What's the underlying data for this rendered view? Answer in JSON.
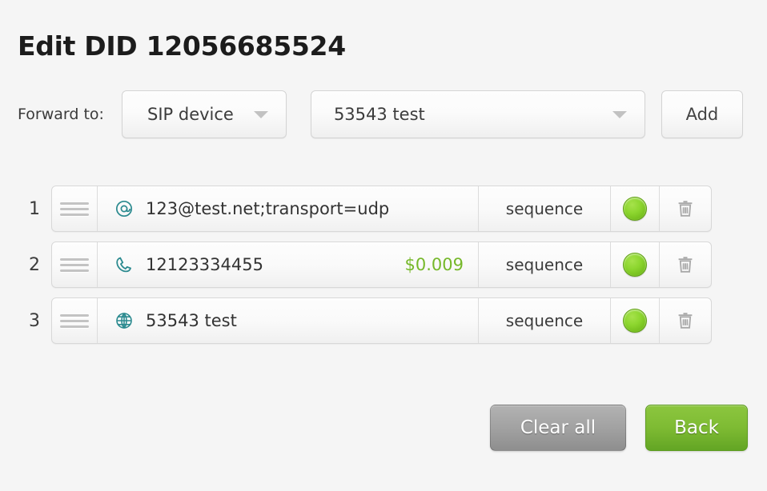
{
  "page": {
    "title": "Edit DID 12056685524",
    "background_color": "#f5f5f5",
    "accent_teal": "#2b8a8f",
    "accent_green": "#76b82a"
  },
  "forward": {
    "label": "Forward to:",
    "type_select": {
      "value": "SIP device",
      "caret_icon": "chevron-down-icon"
    },
    "destination_select": {
      "value": "53543 test",
      "caret_icon": "chevron-down-icon"
    },
    "add_button": "Add"
  },
  "rows": [
    {
      "index": "1",
      "handle_icon": "drag-handle-icon",
      "type_icon": "at-sign-icon",
      "text": "123@test.net;transport=udp",
      "price": "",
      "mode": "sequence",
      "status_icon": "green-led-icon",
      "delete_icon": "trash-icon"
    },
    {
      "index": "2",
      "handle_icon": "drag-handle-icon",
      "type_icon": "phone-icon",
      "text": "12123334455",
      "price": "$0.009",
      "mode": "sequence",
      "status_icon": "green-led-icon",
      "delete_icon": "trash-icon"
    },
    {
      "index": "3",
      "handle_icon": "drag-handle-icon",
      "type_icon": "globe-icon",
      "text": "53543 test",
      "price": "",
      "mode": "sequence",
      "status_icon": "green-led-icon",
      "delete_icon": "trash-icon"
    }
  ],
  "footer": {
    "clear_all": "Clear all",
    "back": "Back"
  }
}
